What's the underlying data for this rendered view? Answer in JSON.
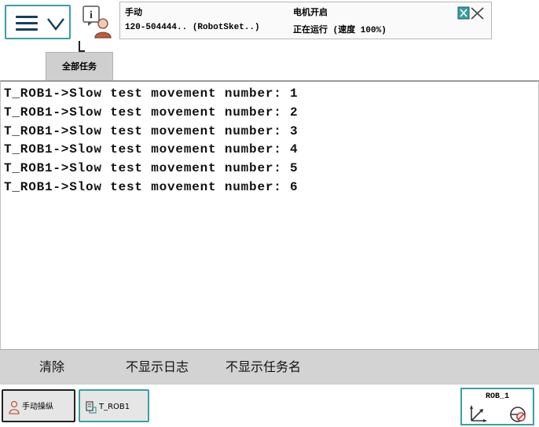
{
  "status": {
    "mode_label": "手动",
    "controller_label": "120-504444.. (RobotSket..)",
    "motors_label": "电机开启",
    "running_label": "正在运行 (速度 100%)"
  },
  "tab": {
    "label": "全部任务"
  },
  "log": {
    "lines": [
      "T_ROB1->Slow test movement number: 1",
      "T_ROB1->Slow test movement number: 2",
      "T_ROB1->Slow test movement number: 3",
      "T_ROB1->Slow test movement number: 4",
      "T_ROB1->Slow test movement number: 5",
      "T_ROB1->Slow test movement number: 6"
    ]
  },
  "commands": {
    "clear": "清除",
    "hide_log": "不显示日志",
    "hide_task": "不显示任务名"
  },
  "taskbar": {
    "manual": "手动操纵",
    "rob": "T_ROB1"
  },
  "quickset": {
    "label": "ROB_1"
  },
  "colors": {
    "accent": "#3a9fa3",
    "dark_blue": "#173f5c",
    "cmdbar_bg": "#d3d3d3"
  },
  "icons": {
    "menu": "hamburger-icon",
    "menu_chevron": "chevron-down-icon",
    "taskview": "info-user-icon",
    "close": "close-icon",
    "manual": "person-icon",
    "rob": "robot-task-icon",
    "axes": "axes-icon",
    "tool": "tool-icon"
  }
}
